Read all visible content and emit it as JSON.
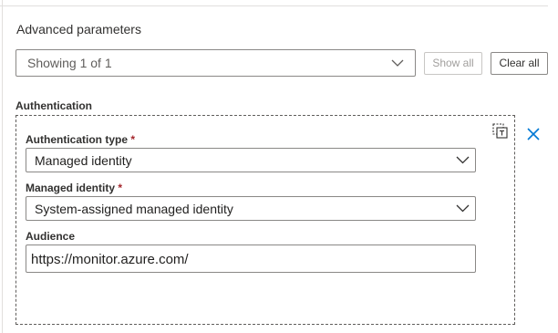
{
  "advanced": {
    "title": "Advanced parameters",
    "showing": "Showing 1 of 1",
    "show_all": "Show all",
    "clear_all": "Clear all"
  },
  "authentication": {
    "section_title": "Authentication",
    "type_label": "Authentication type",
    "type_value": "Managed identity",
    "identity_label": "Managed identity",
    "identity_value": "System-assigned managed identity",
    "audience_label": "Audience",
    "audience_value": "https://monitor.azure.com/",
    "required_mark": "*"
  },
  "icons": {
    "copy": "copy-icon",
    "close": "close-icon",
    "chevron": "chevron-down-icon"
  },
  "colors": {
    "accent": "#0078d4",
    "required": "#a4262c",
    "border": "#8a8886"
  }
}
